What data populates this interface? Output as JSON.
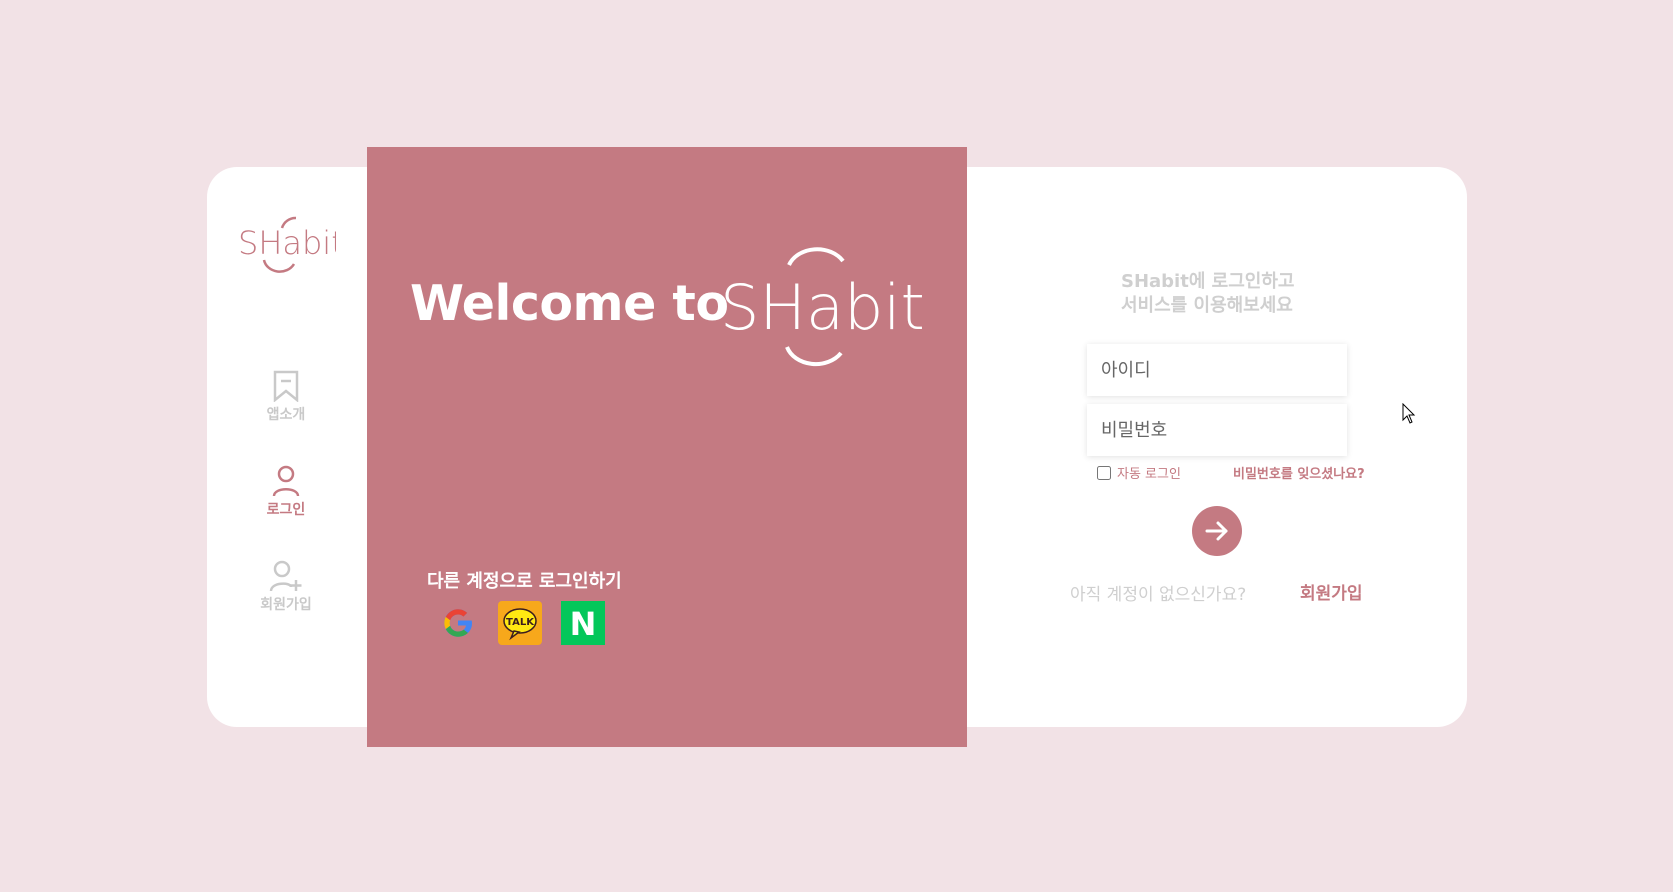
{
  "brand": {
    "name": "SHabit",
    "accent": "#c47a82",
    "background": "#f2e2e6"
  },
  "sidebar": {
    "items": [
      {
        "label": "앱소개",
        "icon": "bookmark-icon",
        "active": false
      },
      {
        "label": "로그인",
        "icon": "user-icon",
        "active": true
      },
      {
        "label": "회원가입",
        "icon": "user-plus-icon",
        "active": false
      }
    ]
  },
  "panel": {
    "welcome": "Welcome to",
    "other_login_title": "다른 계정으로 로그인하기",
    "social": [
      {
        "icon": "google-icon"
      },
      {
        "icon": "kakao-talk-icon",
        "text": "TALK"
      },
      {
        "icon": "naver-icon",
        "text": "N"
      }
    ]
  },
  "login": {
    "intro_line1": "SHabit에 로그인하고",
    "intro_line2": "서비스를 이용해보세요",
    "id_placeholder": "아이디",
    "password_placeholder": "비밀번호",
    "auto_login": "자동 로그인",
    "forgot": "비밀번호를 잊으셨나요?",
    "no_account": "아직 계정이 없으신가요?",
    "signup": "회원가입"
  }
}
